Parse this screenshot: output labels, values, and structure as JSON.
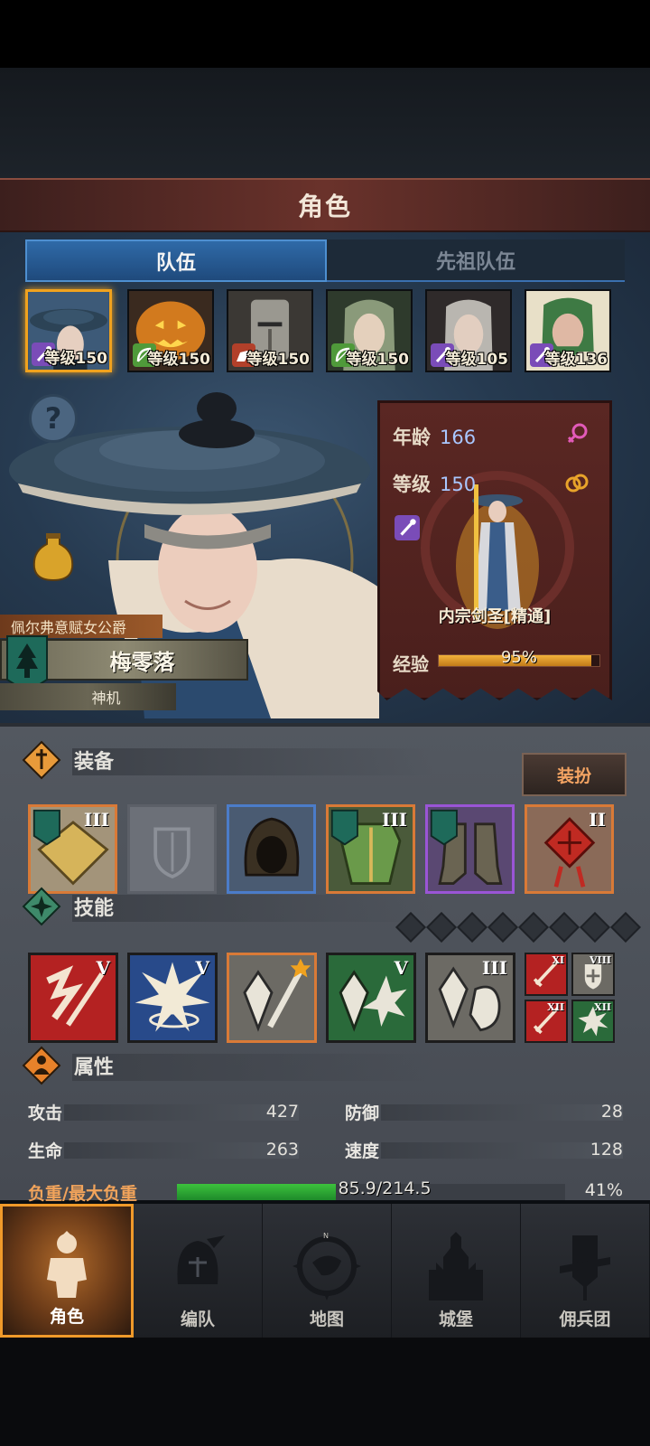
{
  "title": "角色",
  "tabs": [
    "队伍",
    "先祖队伍"
  ],
  "roster": [
    {
      "level": "等级150",
      "class_icon": "staff-icon",
      "selected": true
    },
    {
      "level": "等级150",
      "class_icon": "bow-icon",
      "selected": false
    },
    {
      "level": "等级150",
      "class_icon": "mounted-icon",
      "selected": false
    },
    {
      "level": "等级150",
      "class_icon": "bow-icon",
      "selected": false
    },
    {
      "level": "等级105",
      "class_icon": "staff-icon",
      "selected": false
    },
    {
      "level": "等级136",
      "class_icon": "staff-icon",
      "selected": false
    }
  ],
  "hero": {
    "title": "佩尔弗意赋女公爵",
    "name": "梅零落",
    "trait": "神机"
  },
  "info": {
    "age_label": "年龄",
    "age": "166",
    "level_label": "等级",
    "level": "150",
    "class_name": "内宗剑圣[精通]",
    "exp_label": "经验",
    "exp": "95%",
    "exp_fraction": 0.95
  },
  "equipment": {
    "label": "装备",
    "dress_button": "装扮",
    "items": [
      {
        "tier": "III",
        "icon": "shield-crest-icon",
        "rarity": "orange"
      },
      {
        "tier": "",
        "icon": "empty-shield-slot-icon",
        "rarity": "empty"
      },
      {
        "tier": "",
        "icon": "hood-icon",
        "rarity": "blue"
      },
      {
        "tier": "III",
        "icon": "armor-icon",
        "rarity": "orange"
      },
      {
        "tier": "",
        "icon": "boots-icon",
        "rarity": "purple"
      },
      {
        "tier": "II",
        "icon": "knot-charm-icon",
        "rarity": "orange"
      }
    ]
  },
  "skills": {
    "label": "技能",
    "main": [
      {
        "tier": "V",
        "icon": "sword-strike-icon"
      },
      {
        "tier": "V",
        "icon": "burst-figure-icon"
      },
      {
        "tier": "",
        "icon": "crystal-arrow-icon"
      },
      {
        "tier": "V",
        "icon": "crystal-burst-icon"
      },
      {
        "tier": "III",
        "icon": "crystal-fist-icon"
      }
    ],
    "minor": [
      {
        "tier": "XI",
        "icon": "blade-icon"
      },
      {
        "tier": "VIII",
        "icon": "shield-plus-icon"
      },
      {
        "tier": "XII",
        "icon": "blade-icon"
      },
      {
        "tier": "XII",
        "icon": "starburst-icon"
      }
    ]
  },
  "attributes": {
    "label": "属性",
    "stats": [
      {
        "name": "攻击",
        "value": "427"
      },
      {
        "name": "防御",
        "value": "28"
      },
      {
        "name": "生命",
        "value": "263"
      },
      {
        "name": "速度",
        "value": "128"
      }
    ],
    "load_label": "负重/最大负重",
    "load_value": "85.9/214.5",
    "load_pct": "41%",
    "load_fraction": 0.41
  },
  "nav": [
    "角色",
    "编队",
    "地图",
    "城堡",
    "佣兵团"
  ],
  "colors": {
    "accent": "#f0a21e",
    "rarity_orange": "#d97a37",
    "rarity_blue": "#4b7cc9",
    "rarity_purple": "#9a55d6",
    "load_green": "#3dc23d"
  }
}
